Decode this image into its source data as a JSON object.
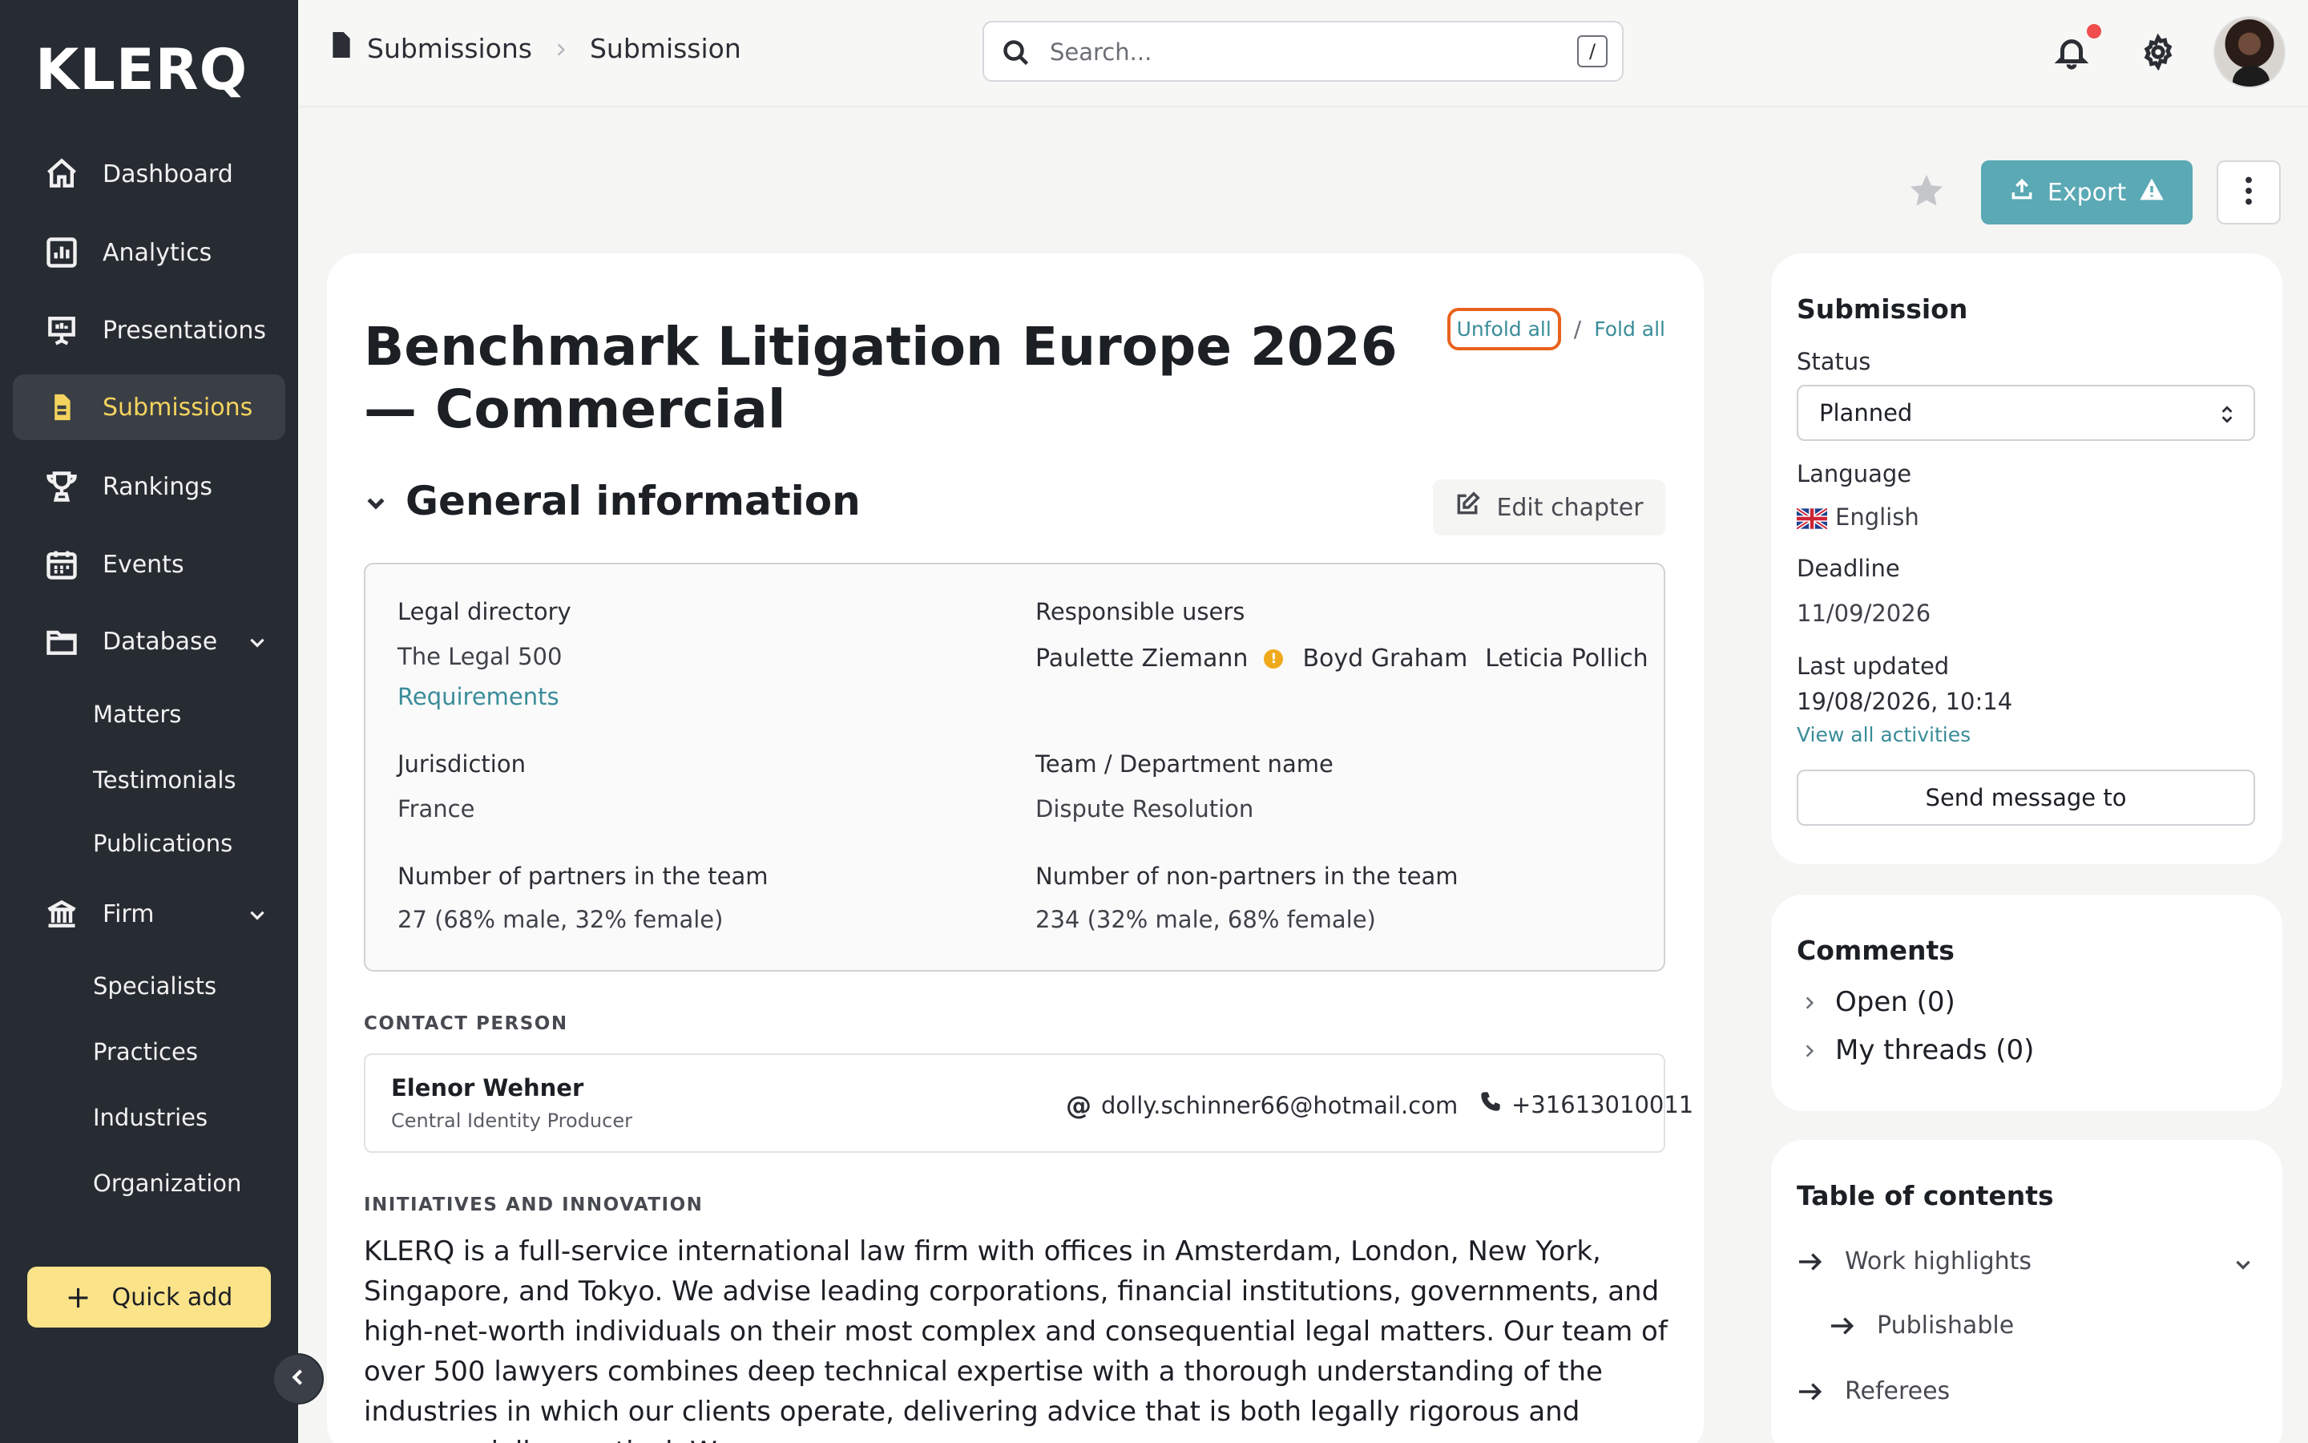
{
  "app": {
    "logo": "KLERQ"
  },
  "sidebar": {
    "items": [
      {
        "label": "Dashboard",
        "icon": "home-icon"
      },
      {
        "label": "Analytics",
        "icon": "analytics-icon"
      },
      {
        "label": "Presentations",
        "icon": "presentation-icon"
      },
      {
        "label": "Submissions",
        "icon": "document-icon",
        "active": true
      },
      {
        "label": "Rankings",
        "icon": "trophy-icon"
      },
      {
        "label": "Events",
        "icon": "calendar-icon"
      },
      {
        "label": "Database",
        "icon": "folder-icon"
      }
    ],
    "database_sub": [
      "Matters",
      "Testimonials",
      "Publications"
    ],
    "firm": {
      "label": "Firm",
      "icon": "bank-icon"
    },
    "firm_sub": [
      "Specialists",
      "Practices",
      "Industries",
      "Organization"
    ],
    "quick_add": "Quick add"
  },
  "topbar": {
    "breadcrumb": [
      "Submissions",
      "Submission"
    ],
    "search_placeholder": "Search...",
    "search_shortcut": "/"
  },
  "actions": {
    "export": "Export"
  },
  "main": {
    "title": "Benchmark Litigation Europe 2026 — Commercial",
    "unfold_all": "Unfold all",
    "fold_sep": "/",
    "fold_all": "Fold all",
    "section_title": "General information",
    "edit_chapter": "Edit chapter",
    "fields": {
      "legal_directory_label": "Legal directory",
      "legal_directory_value": "The Legal 500",
      "requirements_link": "Requirements",
      "responsible_users_label": "Responsible users",
      "responsible_users": [
        "Paulette Ziemann",
        "Boyd Graham",
        "Leticia Pollich"
      ],
      "warn_glyph": "!",
      "jurisdiction_label": "Jurisdiction",
      "jurisdiction_value": "France",
      "team_label": "Team / Department name",
      "team_value": "Dispute Resolution",
      "partners_label": "Number of partners in the team",
      "partners_value": "27 (68% male, 32% female)",
      "nonpartners_label": "Number of non-partners in the team",
      "nonpartners_value": "234 (32% male, 68% female)"
    },
    "contact_heading": "CONTACT PERSON",
    "contact": {
      "name": "Elenor Wehner",
      "role": "Central Identity Producer",
      "email": "dolly.schinner66@hotmail.com",
      "phone": "+31613010011"
    },
    "initiatives_heading": "INITIATIVES AND INNOVATION",
    "initiatives_text": "KLERQ is a full-service international law firm with offices in Amsterdam, London, New York, Singapore, and Tokyo. We advise leading corporations, financial institutions, governments, and high-net-worth individuals on their most complex and consequential legal matters. Our team of over 500 lawyers combines deep technical expertise with a thorough understanding of the industries in which our clients operate, delivering advice that is both legally rigorous and commercially practical. We are"
  },
  "submission_panel": {
    "title": "Submission",
    "status_label": "Status",
    "status_value": "Planned",
    "language_label": "Language",
    "language_value": "English",
    "deadline_label": "Deadline",
    "deadline_value": "11/09/2026",
    "last_updated_label": "Last updated",
    "last_updated_value": "19/08/2026, 10:14",
    "view_activities": "View all activities",
    "send_message": "Send message to"
  },
  "comments_panel": {
    "title": "Comments",
    "items": [
      "Open (0)",
      "My threads (0)"
    ]
  },
  "toc_panel": {
    "title": "Table of contents",
    "items": [
      "Work highlights",
      "Publishable",
      "Referees"
    ]
  },
  "colors": {
    "sidebar_bg": "#272b32",
    "active_accent": "#f4d35e",
    "teal": "#5aa9b5",
    "link": "#3a8c99",
    "highlight_outline": "#e8621d"
  }
}
